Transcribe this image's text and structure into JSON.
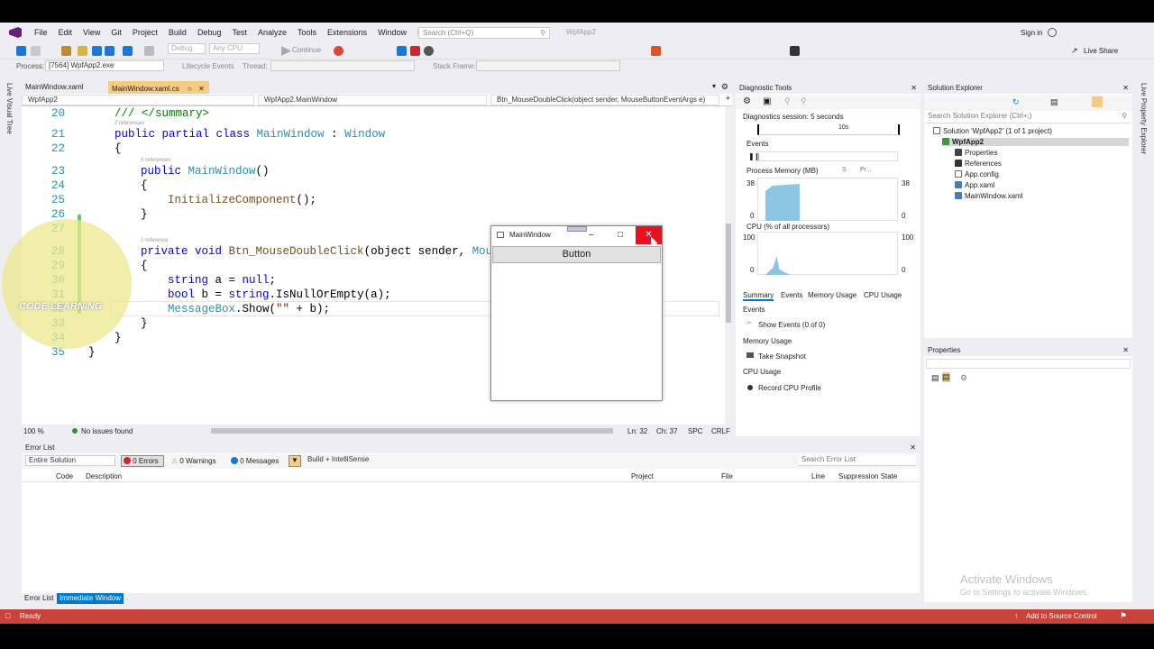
{
  "menu": [
    "File",
    "Edit",
    "View",
    "Git",
    "Project",
    "Build",
    "Debug",
    "Test",
    "Analyze",
    "Tools",
    "Extensions",
    "Window",
    "Help"
  ],
  "search_placeholder": "Search (Ctrl+Q)",
  "solution_title": "WpfApp2",
  "sign_in": "Sign in",
  "live_share": "Live Share",
  "toolbar": {
    "config": "Debug",
    "platform": "Any CPU",
    "continue": "Continue"
  },
  "procbar": {
    "process_label": "Process:",
    "process_value": "[7564] WpfApp2.exe",
    "lifecycle": "Lifecycle Events",
    "thread": "Thread:",
    "stack_frame": "Stack Frame:"
  },
  "side_left": "Live Visual Tree",
  "side_right": "Live Property Explorer",
  "doc_tabs": [
    {
      "label": "MainWindow.xaml"
    },
    {
      "label": "MainWindow.xaml.cs"
    }
  ],
  "nav": {
    "project": "WpfApp2",
    "class": "WpfApp2.MainWindow",
    "member": "Btn_MouseDoubleClick(object sender, MouseButtonEventArgs e)"
  },
  "code": {
    "l20": "20",
    "l21": "21",
    "l22": "22",
    "l23": "23",
    "l24": "24",
    "l25": "25",
    "l26": "26",
    "l27": "27",
    "l28": "28",
    "l29": "29",
    "l30": "30",
    "l31": "31",
    "l32": "32",
    "l33": "33",
    "l34": "34",
    "l35": "35",
    "summary": "/// </summary>",
    "refs2": "2 references",
    "refs0": "0 references",
    "refs1": "1 reference",
    "public_partial_class": "public partial class ",
    "class_name": "MainWindow",
    "colon": " : ",
    "base": "Window",
    "open": "{",
    "close": "}",
    "public": "public ",
    "ctor": "MainWindow",
    "ctor_parens": "()",
    "init": "InitializeComponent",
    "init_rest": "();",
    "private_void": "private void ",
    "handler": "Btn_MouseDoubleClick",
    "handler_args": "(object sender, ",
    "handler_trunc": "Mous",
    "string_kw": "string",
    "a_decl": " a = ",
    "null_kw": "null",
    "semi": ";",
    "bool_kw": "bool",
    "b_decl": " b = ",
    "string_kw2": "string",
    "isnull": ".IsNullOrEmpty(a);",
    "msgbox": "MessageBox",
    "show": ".Show(",
    "empty_str": "\"\"",
    "plus_b": " + b);"
  },
  "editor_status": {
    "zoom": "100 %",
    "issues": "No issues found",
    "ln": "Ln: 32",
    "ch": "Ch: 37",
    "spc": "SPC",
    "crlf": "CRLF"
  },
  "wpf_window": {
    "title": "MainWindow",
    "button_label": "Button"
  },
  "logo_text": "CODE LEARNING",
  "diagnostics": {
    "title": "Diagnostic Tools",
    "session": "Diagnostics session: 5 seconds",
    "timeline_label": "10s",
    "events": "Events",
    "memory_title": "Process Memory (MB)",
    "memory_legend": "S",
    "memory_legend2": "Pr...",
    "mem_max": "38",
    "mem_min": "0",
    "cpu_title": "CPU (% of all processors)",
    "cpu_max": "100",
    "cpu_min": "0",
    "tabs": [
      "Summary",
      "Events",
      "Memory Usage",
      "CPU Usage"
    ],
    "sec_events": "Events",
    "show_events": "Show Events (0 of 0)",
    "sec_memory": "Memory Usage",
    "take_snapshot": "Take Snapshot",
    "sec_cpu": "CPU Usage",
    "record_cpu": "Record CPU Profile"
  },
  "solution_explorer": {
    "title": "Solution Explorer",
    "search": "Search Solution Explorer (Ctrl+;)",
    "items": [
      "Solution 'WpfApp2' (1 of 1 project)",
      "WpfApp2",
      "Properties",
      "References",
      "App.config",
      "App.xaml",
      "MainWindow.xaml"
    ]
  },
  "properties_title": "Properties",
  "error_list": {
    "title": "Error List",
    "scope": "Entire Solution",
    "errors": "0 Errors",
    "warnings": "0 Warnings",
    "messages": "0 Messages",
    "build": "Build + IntelliSense",
    "search": "Search Error List",
    "columns": [
      "Code",
      "Description",
      "Project",
      "File",
      "Line",
      "Suppression State"
    ]
  },
  "bottom_tabs": [
    "Error List",
    "Immediate Window"
  ],
  "activate": {
    "line1": "Activate Windows",
    "line2": "Go to Settings to activate Windows."
  },
  "status": {
    "ready": "Ready",
    "source_control": "Add to Source Control"
  },
  "colors": {
    "accent": "#007acc",
    "statusbar": "#c9423b",
    "close_red": "#e81123"
  }
}
